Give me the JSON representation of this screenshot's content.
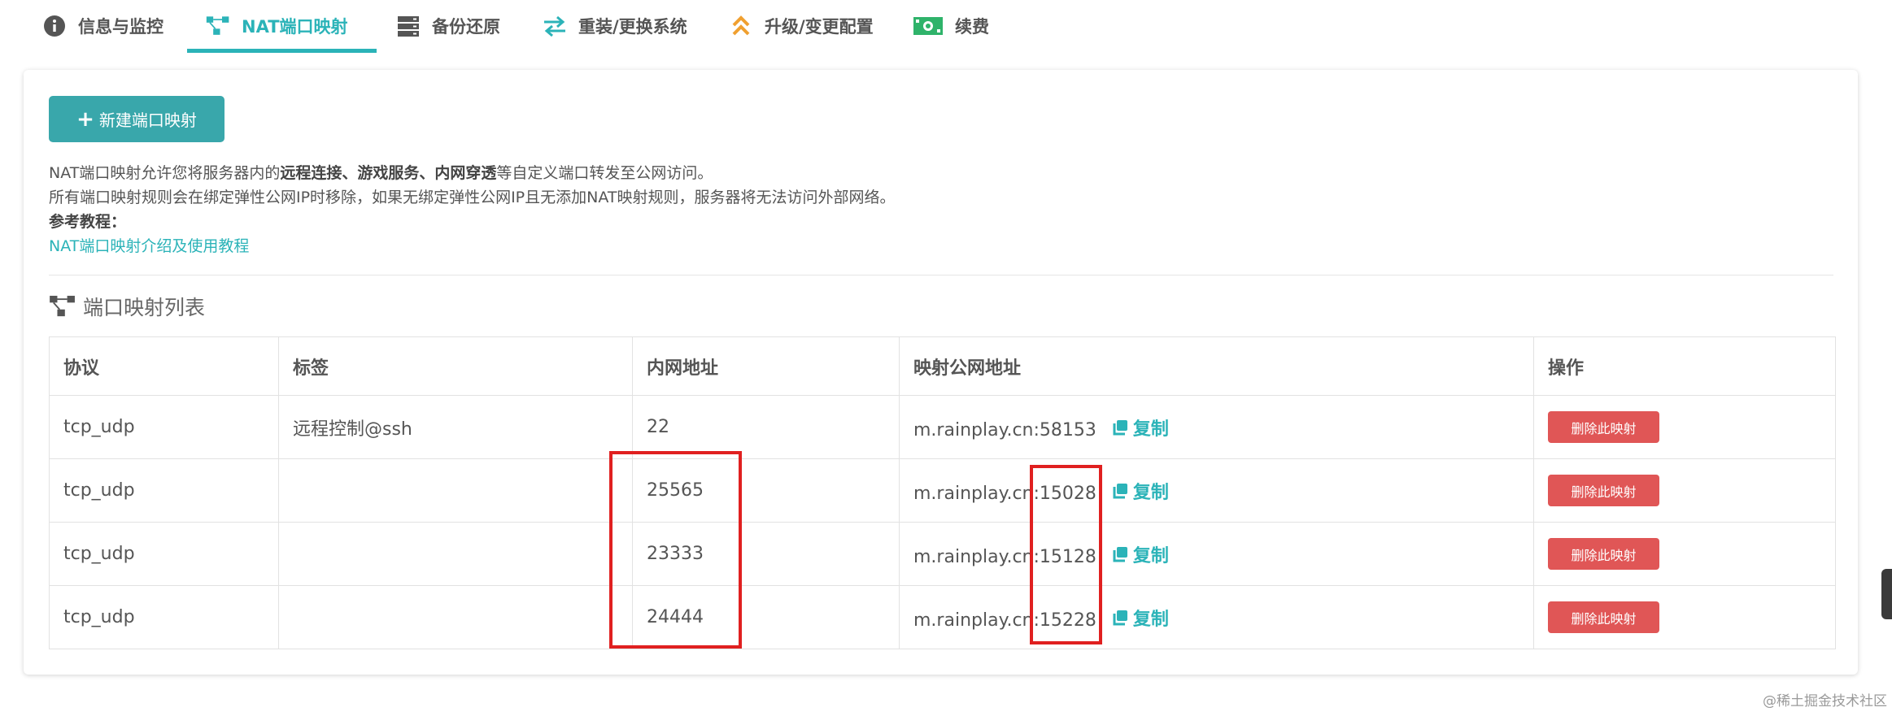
{
  "tabs": [
    {
      "label": "信息与监控",
      "icon": "info-icon",
      "active": false
    },
    {
      "label": "NAT端口映射",
      "icon": "nat-network-icon",
      "active": true
    },
    {
      "label": "备份还原",
      "icon": "server-icon",
      "active": false
    },
    {
      "label": "重装/更换系统",
      "icon": "swap-arrows-icon",
      "active": false
    },
    {
      "label": "升级/变更配置",
      "icon": "double-chevron-up-icon",
      "active": false
    },
    {
      "label": "续费",
      "icon": "money-icon",
      "active": false
    }
  ],
  "new_button": {
    "icon": "plus-icon",
    "label": "新建端口映射"
  },
  "description": {
    "line1_prefix": "NAT端口映射允许您将服务器内的",
    "line1_bold": "远程连接、游戏服务、内网穿透",
    "line1_suffix": "等自定义端口转发至公网访问。",
    "line2": "所有端口映射规则会在绑定弹性公网IP时移除，如果无绑定弹性公网IP且无添加NAT映射规则，服务器将无法访问外部网络。",
    "reference_label": "参考教程：",
    "reference_link": "NAT端口映射介绍及使用教程"
  },
  "list_title": "端口映射列表",
  "table": {
    "headers": [
      "协议",
      "标签",
      "内网地址",
      "映射公网地址",
      "操作"
    ],
    "rows": [
      {
        "protocol": "tcp_udp",
        "tag": "远程控制@ssh",
        "internal": "22",
        "public": "m.rainplay.cn:58153",
        "copy": "复制",
        "action": "删除此映射"
      },
      {
        "protocol": "tcp_udp",
        "tag": "",
        "internal": "25565",
        "public": "m.rainplay.cn:15028",
        "copy": "复制",
        "action": "删除此映射"
      },
      {
        "protocol": "tcp_udp",
        "tag": "",
        "internal": "23333",
        "public": "m.rainplay.cn:15128",
        "copy": "复制",
        "action": "删除此映射"
      },
      {
        "protocol": "tcp_udp",
        "tag": "",
        "internal": "24444",
        "public": "m.rainplay.cn:15228",
        "copy": "复制",
        "action": "删除此映射"
      }
    ]
  },
  "colors": {
    "accent": "#2bb3b8",
    "button": "#39a7ab",
    "danger": "#e05656",
    "annotation": "#e02020",
    "icon_orange": "#f0a030",
    "icon_green": "#2fb36a"
  },
  "watermark": "@稀土掘金技术社区"
}
